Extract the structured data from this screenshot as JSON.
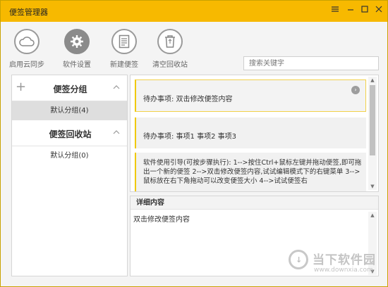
{
  "window": {
    "title": "便签管理器"
  },
  "toolbar": {
    "items": [
      {
        "label": "启用云同步",
        "icon": "cloud-icon"
      },
      {
        "label": "软件设置",
        "icon": "gear-icon"
      },
      {
        "label": "新建便签",
        "icon": "note-icon"
      },
      {
        "label": "清空回收站",
        "icon": "recycle-bin-icon"
      }
    ],
    "search_placeholder": "搜索关键字"
  },
  "sidebar": {
    "groups_title": "便签分组",
    "groups": [
      {
        "label": "默认分组(4)",
        "selected": true
      }
    ],
    "recycle_title": "便签回收站",
    "recycle": [
      {
        "label": "默认分组(0)"
      }
    ]
  },
  "notes": [
    {
      "text": "待办事项:  双击修改便签内容"
    },
    {
      "text": "待办事项:  事项1 事项2 事项3"
    },
    {
      "text": "软件使用引导(可按步骤执行): 1-->按住Ctrl+鼠标左键并拖动便签,即可拖出一个新的便签 2-->双击修改便签内容,试试编辑模式下的右键菜单 3-->鼠标放在右下角拖动可以改变便签大小 4-->试试便签右"
    }
  ],
  "detail": {
    "title": "详细内容",
    "content": "双击修改便签内容"
  },
  "watermark": {
    "title": "当下软件园",
    "url": "www.downxia.com"
  },
  "colors": {
    "accent": "#f7b900",
    "note_border": "#f0c900"
  }
}
